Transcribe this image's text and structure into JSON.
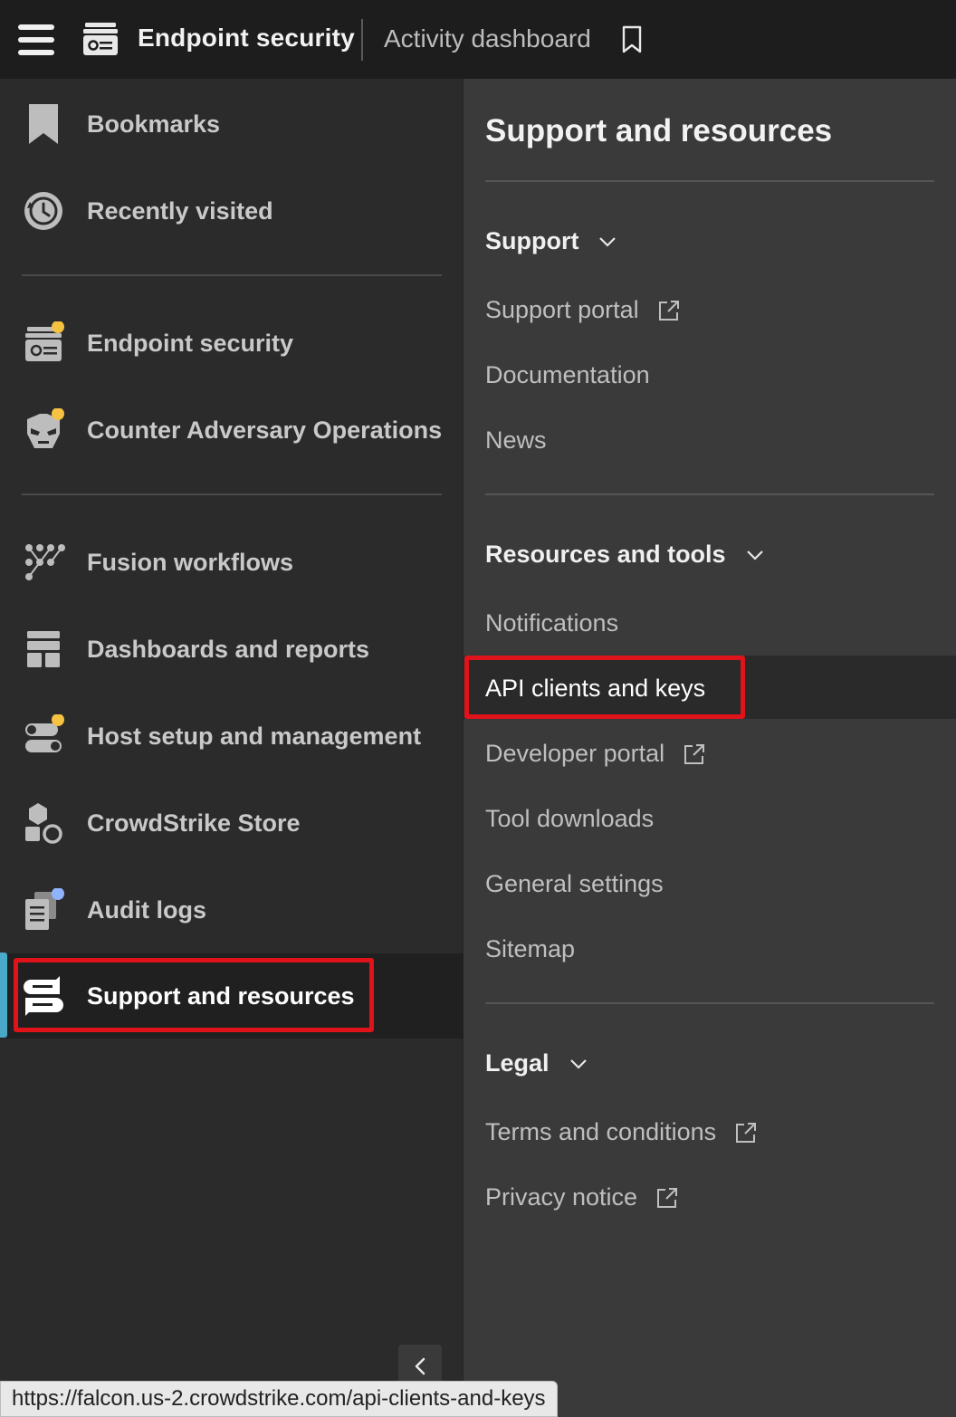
{
  "topbar": {
    "app_title": "Endpoint security",
    "page_title": "Activity dashboard"
  },
  "sidebar": {
    "items": [
      {
        "label": "Bookmarks",
        "icon": "bookmark-icon"
      },
      {
        "label": "Recently visited",
        "icon": "history-icon"
      },
      {
        "label": "Endpoint security",
        "icon": "endpoint-security-icon",
        "badge": "#f5c242"
      },
      {
        "label": "Counter Adversary Operations",
        "icon": "adversary-mask-icon",
        "badge": "#f5c242"
      },
      {
        "label": "Fusion workflows",
        "icon": "workflow-icon"
      },
      {
        "label": "Dashboards and reports",
        "icon": "dashboard-icon"
      },
      {
        "label": "Host setup and management",
        "icon": "toggles-icon",
        "badge": "#f5c242"
      },
      {
        "label": "CrowdStrike Store",
        "icon": "store-icon"
      },
      {
        "label": "Audit logs",
        "icon": "audit-logs-icon",
        "badge": "#8fb3ff"
      },
      {
        "label": "Support and resources",
        "icon": "support-icon",
        "active": true
      }
    ]
  },
  "panel": {
    "title": "Support and resources",
    "sections": [
      {
        "heading": "Support",
        "links": [
          {
            "label": "Support portal",
            "external": true
          },
          {
            "label": "Documentation"
          },
          {
            "label": "News"
          }
        ]
      },
      {
        "heading": "Resources and tools",
        "links": [
          {
            "label": "Notifications"
          },
          {
            "label": "API clients and keys",
            "active": true
          },
          {
            "label": "Developer portal",
            "external": true
          },
          {
            "label": "Tool downloads"
          },
          {
            "label": "General settings"
          },
          {
            "label": "Sitemap"
          }
        ]
      },
      {
        "heading": "Legal",
        "links": [
          {
            "label": "Terms and conditions",
            "external": true
          },
          {
            "label": "Privacy notice",
            "external": true
          }
        ]
      }
    ]
  },
  "status_url": "https://falcon.us-2.crowdstrike.com/api-clients-and-keys",
  "colors": {
    "highlight": "#e0121a",
    "active_bar": "#4aa8c8",
    "badge_yellow": "#f5c242",
    "badge_blue": "#8fb3ff"
  }
}
